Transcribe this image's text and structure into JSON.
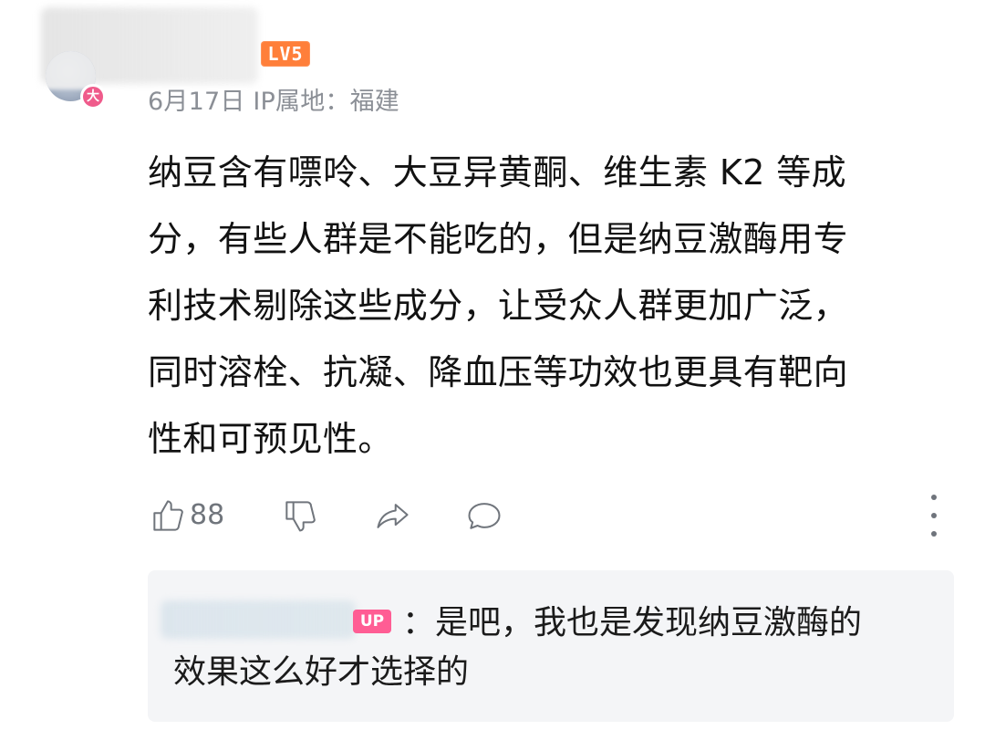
{
  "comment": {
    "author_initial_badge": "大",
    "level_badge": "LV5",
    "date": "6月17日",
    "ip_location": "IP属地：福建",
    "body_lines": [
      "纳豆含有嘌呤、大豆异黄酮、维生素 K2 等成",
      "分，有些人群是不能吃的，但是纳豆激酶用专",
      "利技术剔除这些成分，让受众人群更加广泛，",
      "同时溶栓、抗凝、降血压等功效也更具有靶向",
      "性和可预见性。"
    ],
    "actions": {
      "like_count": "88",
      "like_icon": "thumbs-up-icon",
      "dislike_icon": "thumbs-down-icon",
      "share_icon": "share-icon",
      "reply_icon": "chat-bubble-icon",
      "more_icon": "more-vertical-icon"
    }
  },
  "reply": {
    "up_badge": "UP",
    "line1": "：是吧，我也是发现纳豆激酶的",
    "line2": "效果这么好才选择的"
  },
  "colors": {
    "level_badge": "#ff7f3a",
    "avatar_badge": "#ef5b8b",
    "up_badge": "#ff5d94",
    "meta_text": "#8b8f96",
    "reply_bg": "#f4f5f7"
  }
}
